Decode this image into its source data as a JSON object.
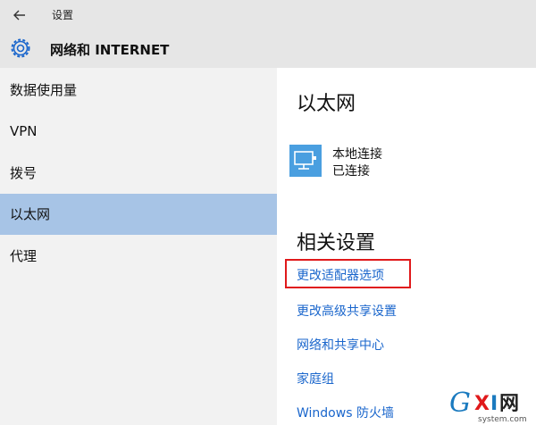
{
  "window": {
    "title": "设置"
  },
  "header": {
    "title": "网络和 INTERNET"
  },
  "sidebar": {
    "items": [
      {
        "label": "数据使用量"
      },
      {
        "label": "VPN"
      },
      {
        "label": "拨号"
      },
      {
        "label": "以太网"
      },
      {
        "label": "代理"
      }
    ],
    "active": "以太网"
  },
  "content": {
    "title": "以太网",
    "connection": {
      "name": "本地连接",
      "status": "已连接"
    },
    "related_title": "相关设置",
    "links": [
      {
        "label": "更改适配器选项"
      },
      {
        "label": "更改高级共享设置"
      },
      {
        "label": "网络和共享中心"
      },
      {
        "label": "家庭组"
      },
      {
        "label": "Windows 防火墙"
      }
    ]
  },
  "watermark": {
    "text": "GXI网",
    "subtext": "system.com"
  },
  "colors": {
    "accent": "#1a66cc",
    "active_nav": "#a7c4e6",
    "highlight": "#e0191b",
    "icon": "#4a9fe0"
  }
}
